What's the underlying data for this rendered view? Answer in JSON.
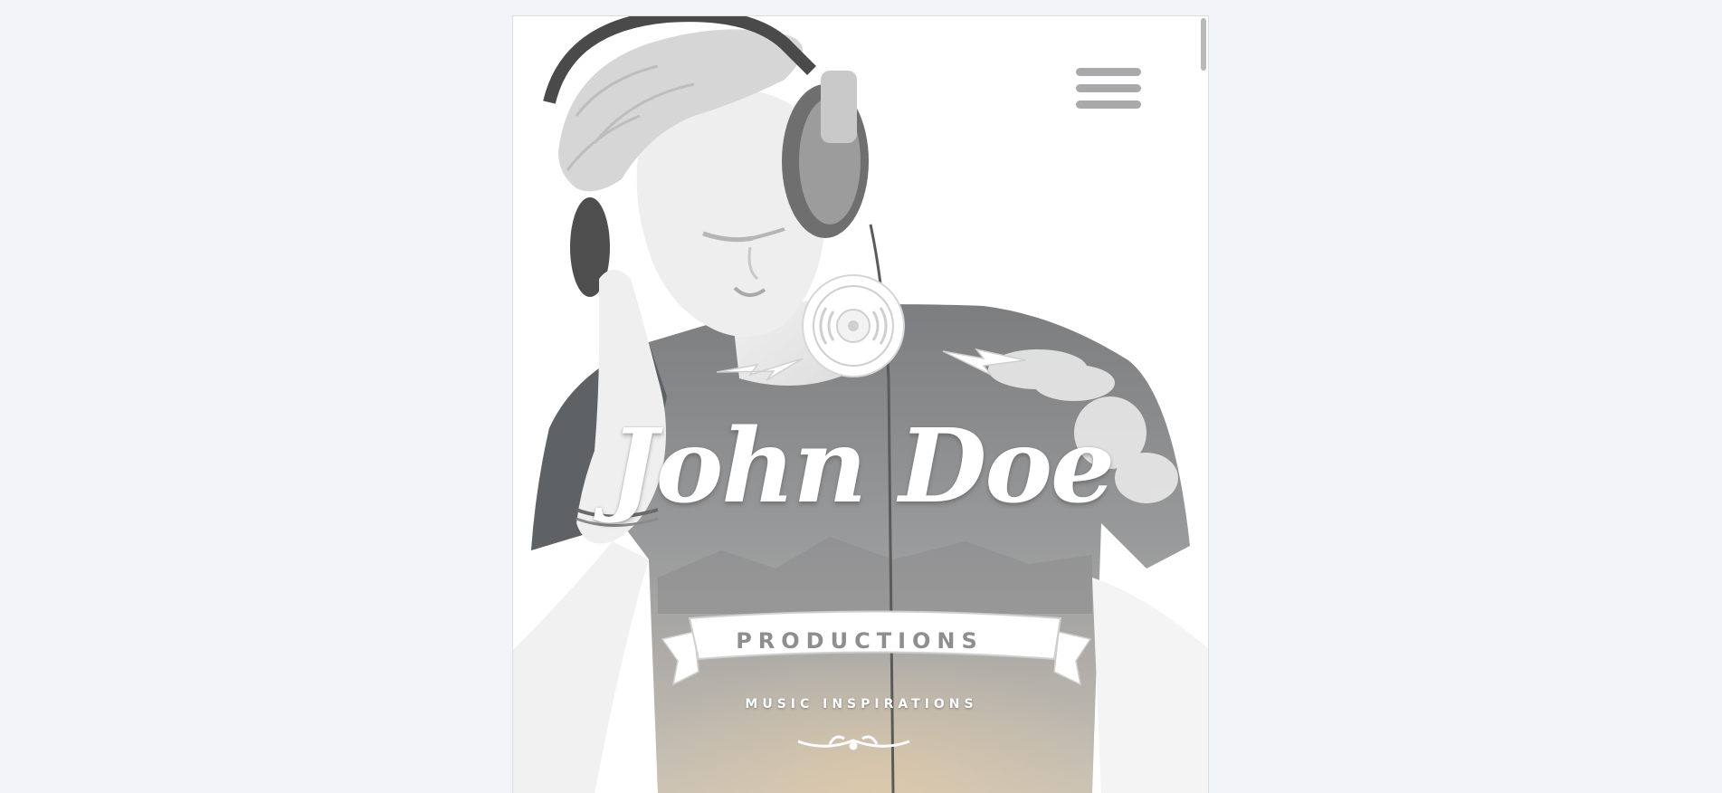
{
  "hero": {
    "name": "John Doe",
    "banner": "PRODUCTIONS",
    "tagline": "MUSIC INSPIRATIONS"
  },
  "header": {
    "menu_icon": "hamburger-menu-icon"
  },
  "logo": {
    "icon": "vinyl-record-icon",
    "ornament": "flourish-ornament-icon"
  },
  "colors": {
    "page_background": "#f3f4f7",
    "text_white": "#ffffff",
    "banner_text": "#8e8e90",
    "menu_bars": "#a9a9ab"
  }
}
